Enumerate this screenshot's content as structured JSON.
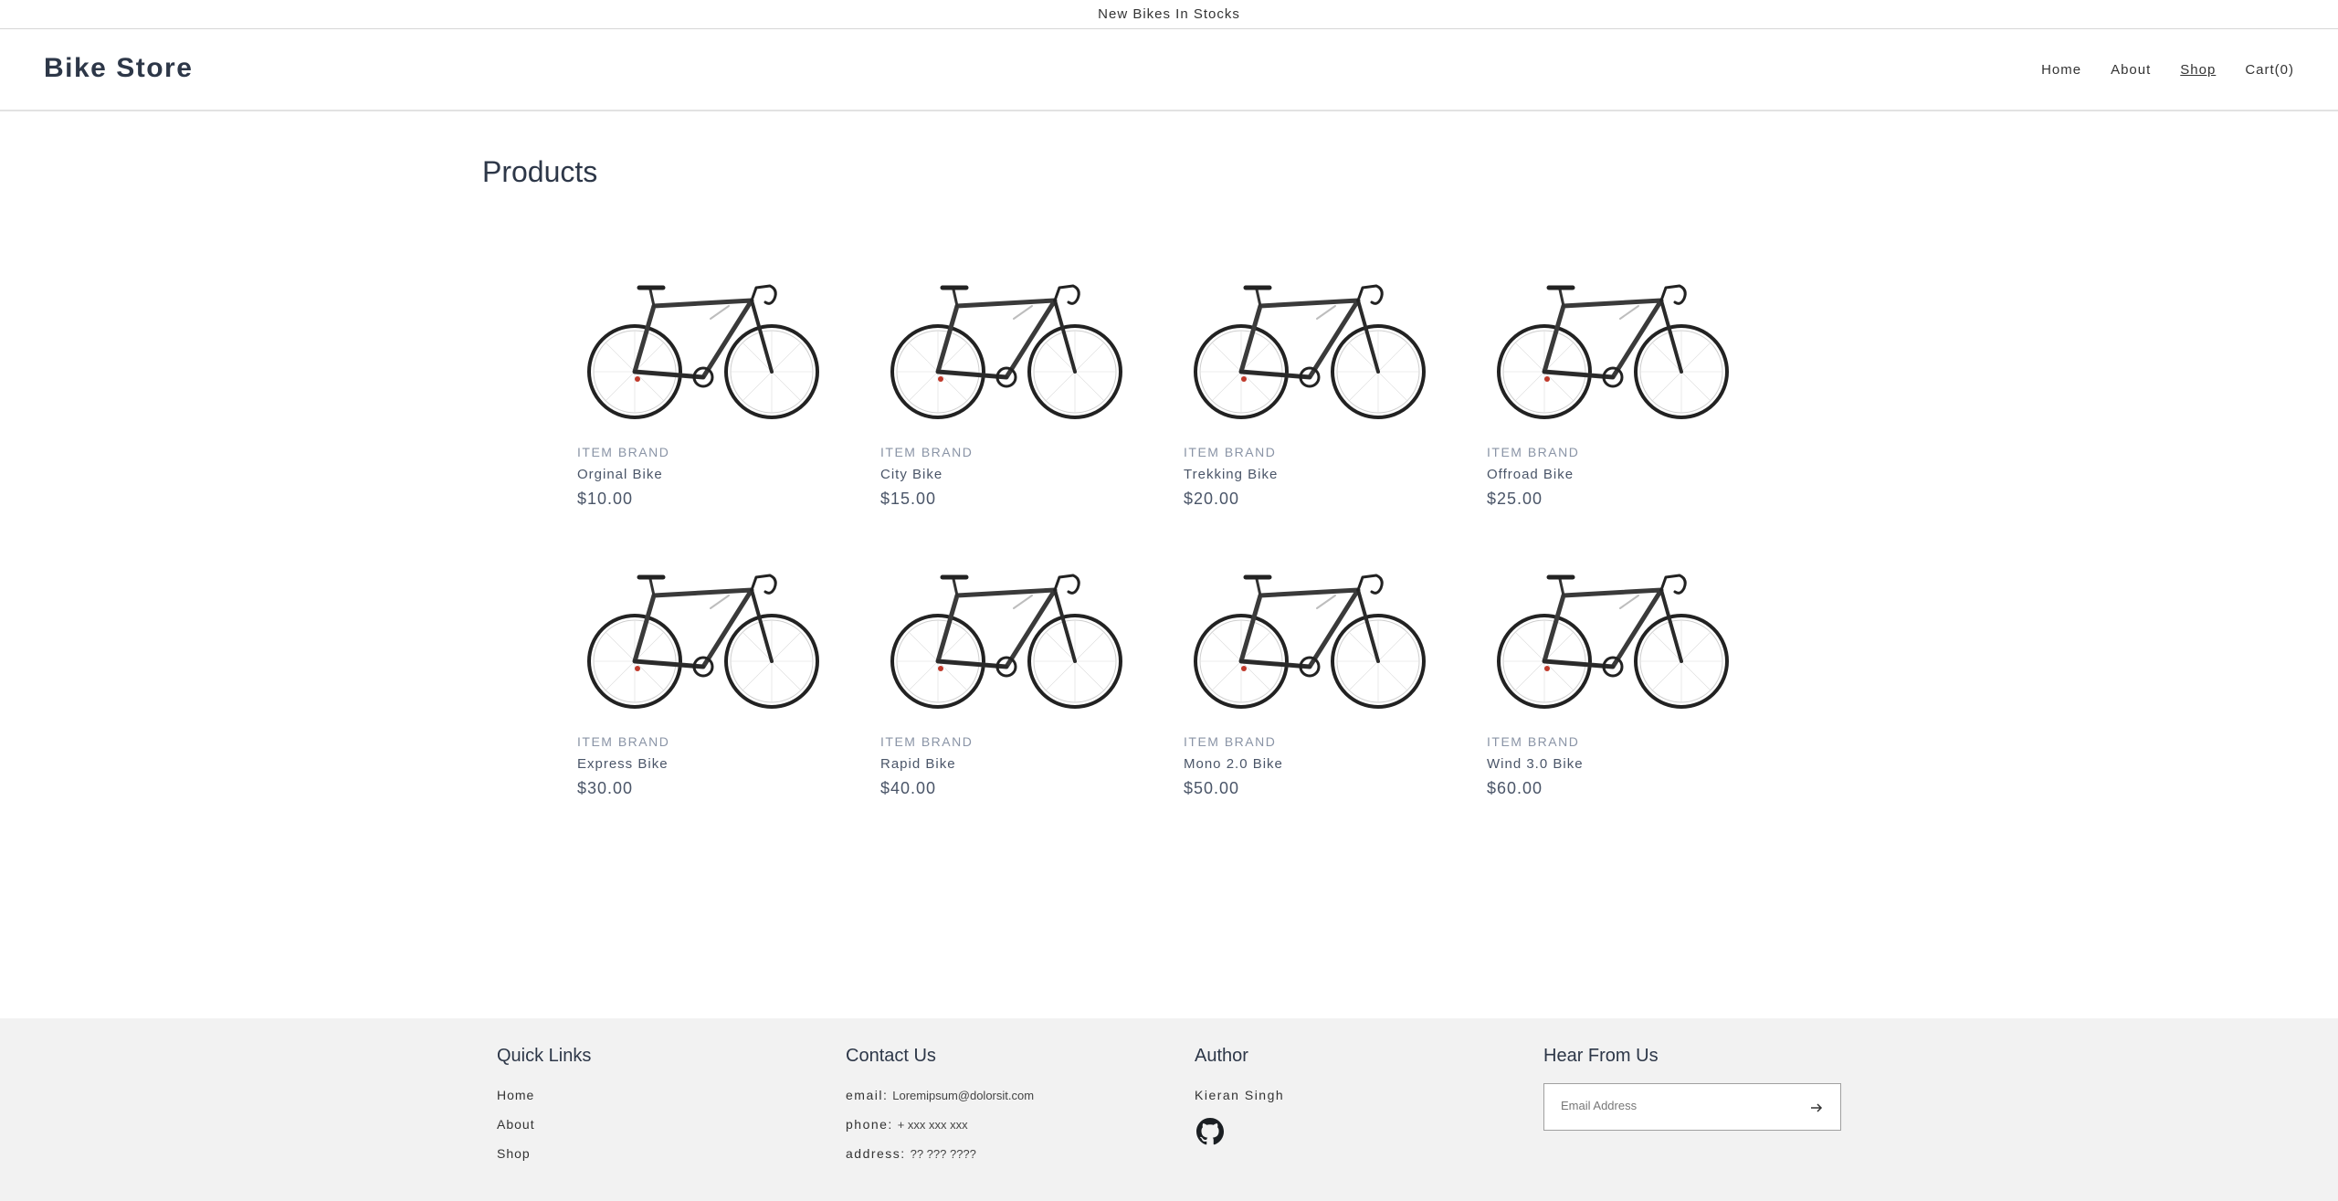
{
  "announcement": "New Bikes In Stocks",
  "header": {
    "brand": "Bike Store",
    "nav": [
      {
        "label": "Home",
        "active": false
      },
      {
        "label": "About",
        "active": false
      },
      {
        "label": "Shop",
        "active": true
      },
      {
        "label": "Cart(0)",
        "active": false
      }
    ]
  },
  "main": {
    "title": "Products",
    "products": [
      {
        "brand": "ITEM BRAND",
        "name": "Orginal Bike",
        "price": "$10.00"
      },
      {
        "brand": "ITEM BRAND",
        "name": "City Bike",
        "price": "$15.00"
      },
      {
        "brand": "ITEM BRAND",
        "name": "Trekking Bike",
        "price": "$20.00"
      },
      {
        "brand": "ITEM BRAND",
        "name": "Offroad Bike",
        "price": "$25.00"
      },
      {
        "brand": "ITEM BRAND",
        "name": "Express Bike",
        "price": "$30.00"
      },
      {
        "brand": "ITEM BRAND",
        "name": "Rapid Bike",
        "price": "$40.00"
      },
      {
        "brand": "ITEM BRAND",
        "name": "Mono 2.0 Bike",
        "price": "$50.00"
      },
      {
        "brand": "ITEM BRAND",
        "name": "Wind 3.0 Bike",
        "price": "$60.00"
      }
    ]
  },
  "footer": {
    "quick_links": {
      "title": "Quick Links",
      "links": [
        "Home",
        "About",
        "Shop"
      ]
    },
    "contact": {
      "title": "Contact Us",
      "email_label": "email:",
      "email": "Loremipsum@dolorsit.com",
      "phone_label": "phone:",
      "phone": "+ xxx xxx xxx",
      "address_label": "address:",
      "address": "?? ??? ????"
    },
    "author": {
      "title": "Author",
      "name": "Kieran Singh",
      "icon": "github-icon"
    },
    "newsletter": {
      "title": "Hear From Us",
      "placeholder": "Email Address",
      "submit_icon": "arrow-right-icon"
    }
  }
}
